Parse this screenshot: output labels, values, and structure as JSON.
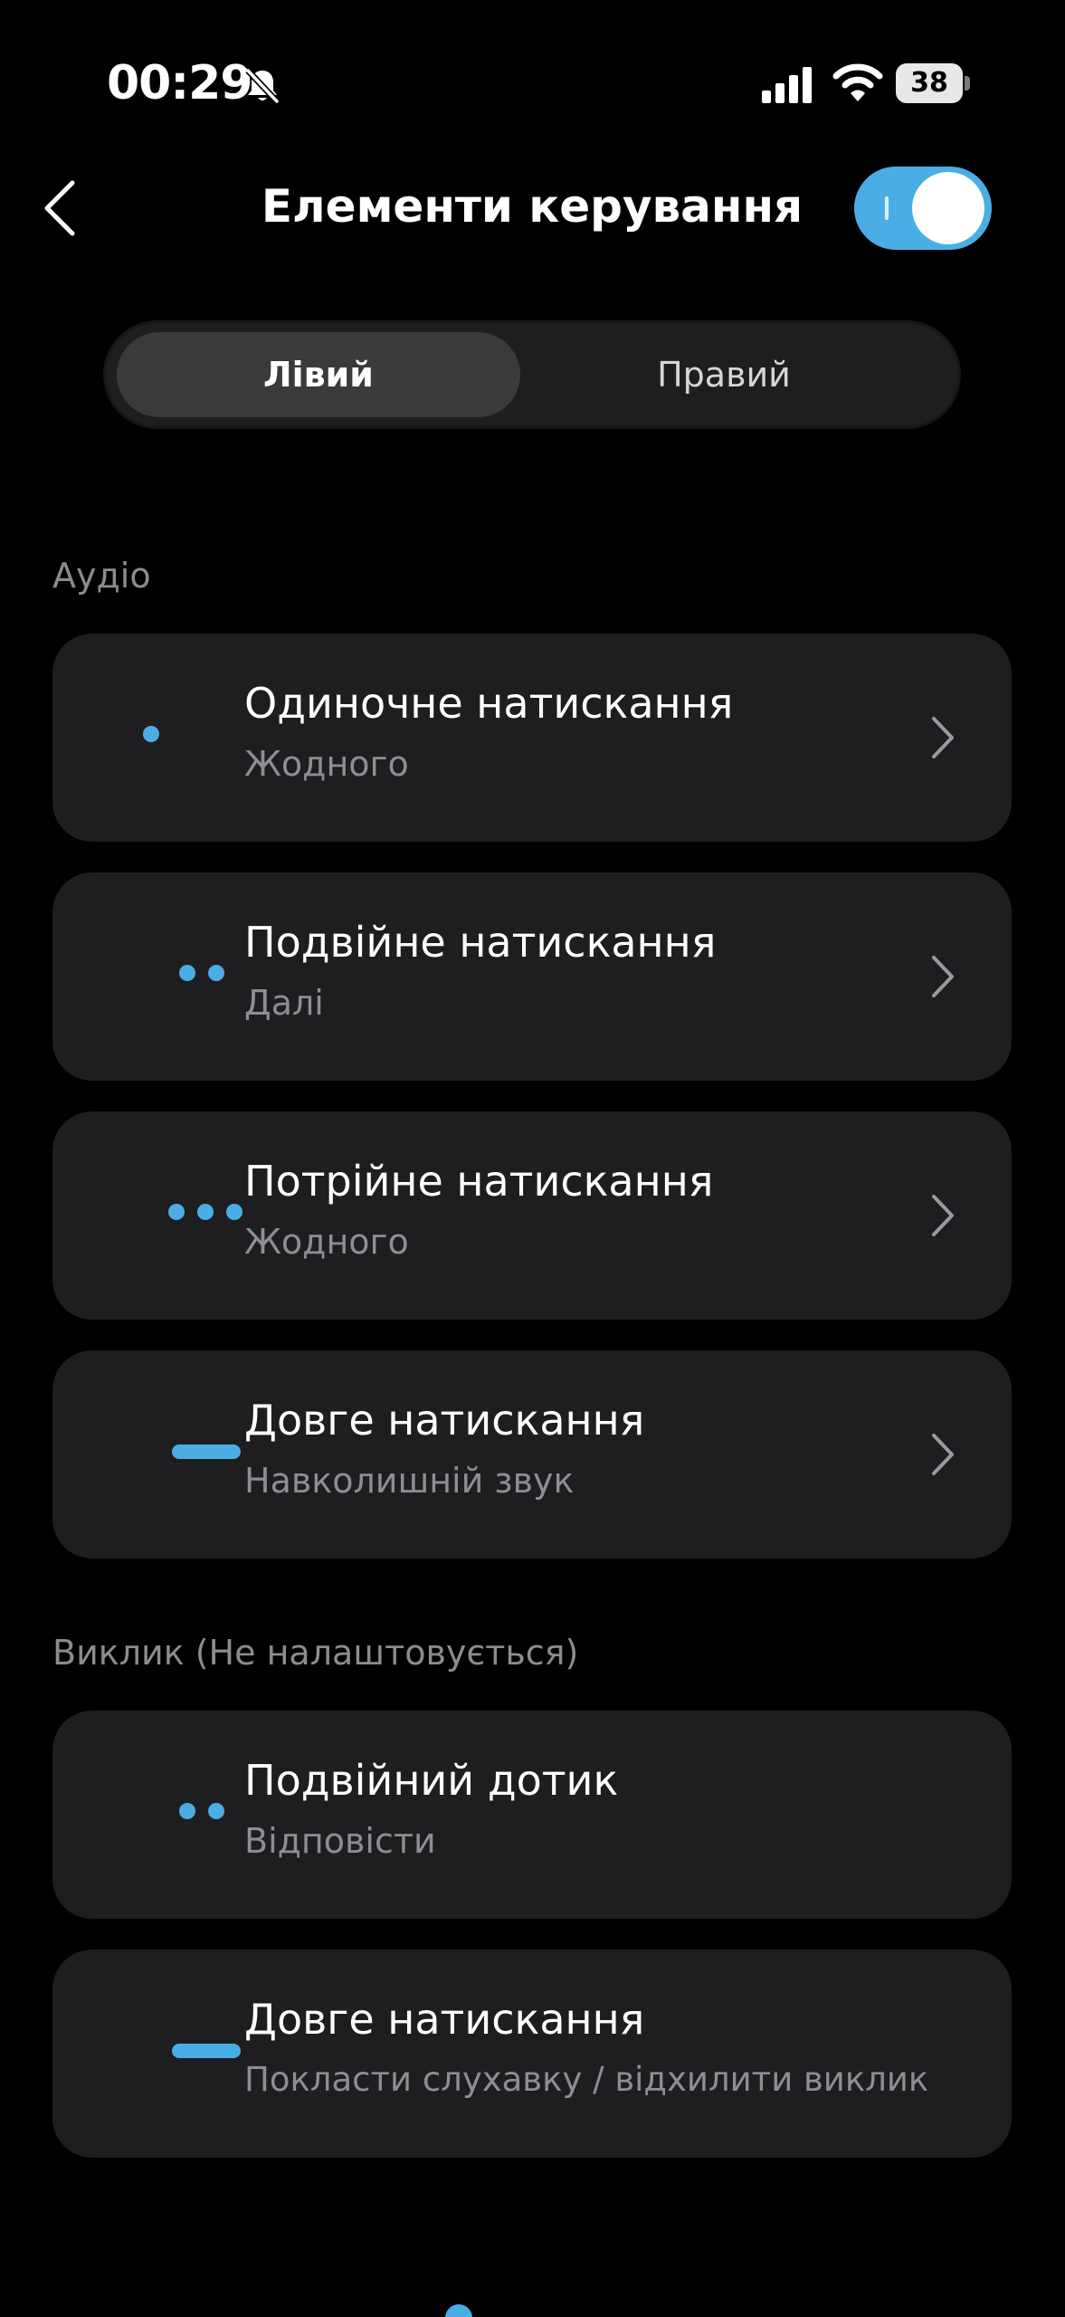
{
  "status_bar": {
    "time": "00:29",
    "battery": "38",
    "icons": [
      "bell-off-icon",
      "cellular-signal-icon",
      "wifi-icon",
      "battery-icon"
    ]
  },
  "header": {
    "title": "Елементи керування",
    "back_icon": "chevron-left-icon",
    "toggle_on": true
  },
  "tabs": [
    {
      "label": "Лівий",
      "selected": true
    },
    {
      "label": "Правий",
      "selected": false
    }
  ],
  "sections": [
    {
      "label": "Аудіо",
      "items": [
        {
          "icon": "single-dot-icon",
          "title": "Одиночне натискання",
          "value": "Жодного"
        },
        {
          "icon": "double-dot-icon",
          "title": "Подвійне натискання",
          "value": "Далі"
        },
        {
          "icon": "triple-dot-icon",
          "title": "Потрійне натискання",
          "value": "Жодного"
        },
        {
          "icon": "long-press-dash-icon",
          "title": "Довге натискання",
          "value": "Навколишній звук"
        }
      ]
    },
    {
      "label": "Виклик (Не налаштовується)",
      "items": [
        {
          "icon": "double-dot-icon",
          "title": "Подвійний дотик",
          "value": "Відповісти"
        },
        {
          "icon": "long-press-dash-icon",
          "title": "Довге натискання",
          "value": "Покласти слухавку / відхилити виклик"
        }
      ]
    }
  ],
  "colors": {
    "accent": "#4aaee4",
    "background": "#000000",
    "card": "#1e1e20",
    "secondary_text": "#8e8e92"
  }
}
